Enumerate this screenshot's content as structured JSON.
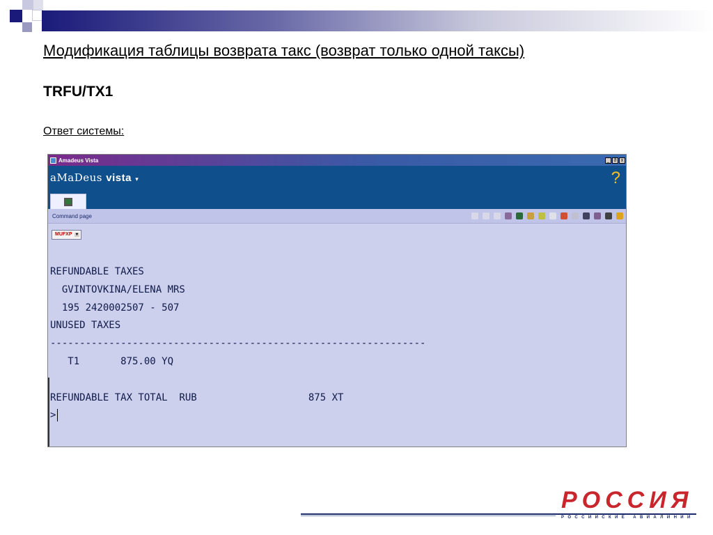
{
  "slide": {
    "title": "Модификация таблицы возврата такс (возврат только одной таксы)",
    "command": "TRFU/TX1",
    "answer_label": "Ответ системы:"
  },
  "terminal_window": {
    "title": "Amadeus Vista",
    "controls": [
      "_",
      "ð",
      "x"
    ],
    "brand_light": "aMaDeus ",
    "brand_strong": "vista",
    "brand_arrow": "▾",
    "help": "?",
    "command_page_label": "Command page",
    "office_select": "MUFXP",
    "toolbar_icons": [
      "hold-icon",
      "play-icon",
      "stop-icon",
      "cut-icon",
      "book-icon",
      "pen-icon",
      "marker-icon",
      "blank-icon",
      "globe-icon",
      "note-icon",
      "copy-icon",
      "edit-icon",
      "print-icon",
      "help-icon"
    ],
    "toolbar_colors": [
      "#d8d8e8",
      "#d8d8e8",
      "#d8d8e8",
      "#8a6a9a",
      "#2a6a3a",
      "#c8a040",
      "#c0c040",
      "#e0e0e8",
      "#d05030",
      "#c0c0d0",
      "#404060",
      "#806090",
      "#404040",
      "#e0a020"
    ],
    "lines": [
      "REFUNDABLE TAXES",
      "  GVINTOVKINA/ELENA MRS",
      "  195 2420002507 - 507",
      "UNUSED TAXES",
      "----------------------------------------------------------------",
      "   T1       875.00 YQ",
      "",
      "REFUNDABLE TAX TOTAL  RUB                   875 XT",
      ">"
    ]
  },
  "logo": {
    "name": "РОССИЯ",
    "subtitle": "РОССИЙСКИЕ АВИАЛИНИИ"
  }
}
